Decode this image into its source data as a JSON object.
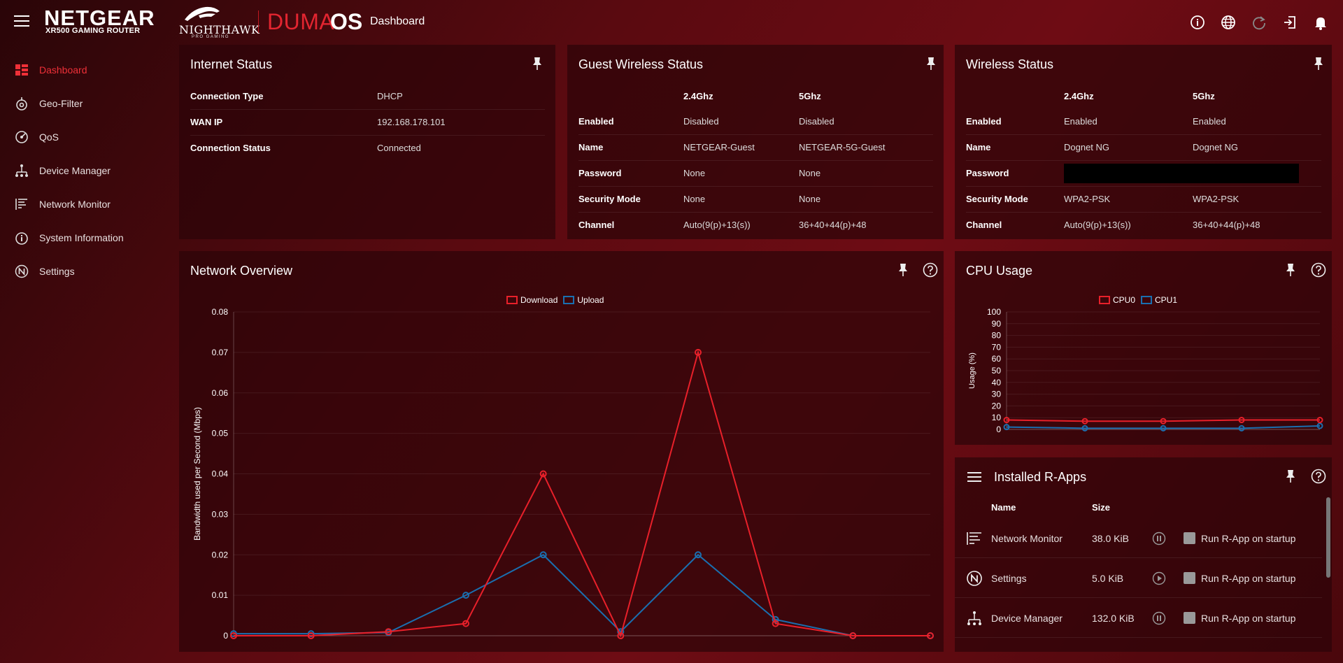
{
  "header": {
    "brand": "NETGEAR",
    "model": "XR500 GAMING ROUTER",
    "nighthawk": "NIGHTHAWK",
    "nighthawk_sub": "PRO GAMING",
    "duma": "DUMA",
    "os": "OS",
    "page_title": "Dashboard",
    "icons": [
      "info-icon",
      "globe-icon",
      "refresh-icon",
      "logout-icon",
      "bell-icon"
    ]
  },
  "sidebar": {
    "items": [
      {
        "label": "Dashboard",
        "icon": "dashboard-icon",
        "active": true
      },
      {
        "label": "Geo-Filter",
        "icon": "geo-filter-icon"
      },
      {
        "label": "QoS",
        "icon": "qos-icon"
      },
      {
        "label": "Device Manager",
        "icon": "device-manager-icon"
      },
      {
        "label": "Network Monitor",
        "icon": "network-monitor-icon"
      },
      {
        "label": "System Information",
        "icon": "system-info-icon"
      },
      {
        "label": "Settings",
        "icon": "settings-icon"
      }
    ]
  },
  "internet_status": {
    "title": "Internet Status",
    "rows": [
      {
        "key": "Connection Type",
        "value": "DHCP"
      },
      {
        "key": "WAN IP",
        "value": "192.168.178.101"
      },
      {
        "key": "Connection Status",
        "value": "Connected"
      }
    ]
  },
  "guest_wireless": {
    "title": "Guest Wireless Status",
    "col1": "2.4Ghz",
    "col2": "5Ghz",
    "rows": [
      {
        "key": "Enabled",
        "v1": "Disabled",
        "v2": "Disabled"
      },
      {
        "key": "Name",
        "v1": "NETGEAR-Guest",
        "v2": "NETGEAR-5G-Guest"
      },
      {
        "key": "Password",
        "v1": "None",
        "v2": "None"
      },
      {
        "key": "Security Mode",
        "v1": "None",
        "v2": "None"
      },
      {
        "key": "Channel",
        "v1": "Auto(9(p)+13(s))",
        "v2": "36+40+44(p)+48"
      }
    ]
  },
  "wireless": {
    "title": "Wireless Status",
    "col1": "2.4Ghz",
    "col2": "5Ghz",
    "rows": [
      {
        "key": "Enabled",
        "v1": "Enabled",
        "v2": "Enabled"
      },
      {
        "key": "Name",
        "v1": "Dognet NG",
        "v2": "Dognet NG"
      },
      {
        "key": "Password",
        "v1": "",
        "v2": "",
        "redacted": true
      },
      {
        "key": "Security Mode",
        "v1": "WPA2-PSK",
        "v2": "WPA2-PSK"
      },
      {
        "key": "Channel",
        "v1": "Auto(9(p)+13(s))",
        "v2": "36+40+44(p)+48"
      }
    ]
  },
  "network_overview": {
    "title": "Network Overview",
    "legend": [
      "Download",
      "Upload"
    ]
  },
  "cpu_usage": {
    "title": "CPU Usage",
    "legend": [
      "CPU0",
      "CPU1"
    ]
  },
  "rapps": {
    "title": "Installed R-Apps",
    "col_name": "Name",
    "col_size": "Size",
    "startup_label": "Run R-App on startup",
    "items": [
      {
        "name": "Network Monitor",
        "size": "38.0 KiB",
        "icon": "network-monitor-icon",
        "state": "pause"
      },
      {
        "name": "Settings",
        "size": "5.0 KiB",
        "icon": "settings-icon",
        "state": "play"
      },
      {
        "name": "Device Manager",
        "size": "132.0 KiB",
        "icon": "device-manager-icon",
        "state": "pause"
      }
    ]
  },
  "colors": {
    "download": "#e8202a",
    "upload": "#1a6fb0",
    "accent": "#ef3038"
  },
  "chart_data": [
    {
      "type": "line",
      "x": [
        0,
        1,
        2,
        3,
        4,
        5,
        6,
        7,
        8,
        9
      ],
      "series": [
        {
          "name": "Download",
          "values": [
            0,
            0,
            0.001,
            0.003,
            0.04,
            0,
            0.07,
            0.003,
            0,
            0
          ]
        },
        {
          "name": "Upload",
          "values": [
            0.0005,
            0.0005,
            0.0008,
            0.01,
            0.02,
            0.001,
            0.02,
            0.004,
            0,
            0
          ]
        }
      ],
      "title": "",
      "xlabel": "",
      "ylabel": "Bandwidth used per Second (Mbps)",
      "ylim": [
        0,
        0.08
      ],
      "yticks": [
        "0",
        "0.01",
        "0.02",
        "0.03",
        "0.04",
        "0.05",
        "0.06",
        "0.07",
        "0.08"
      ],
      "grid": true,
      "legend": "top-center"
    },
    {
      "type": "line",
      "x": [
        0,
        1,
        2,
        3,
        4
      ],
      "series": [
        {
          "name": "CPU0",
          "values": [
            8,
            7,
            7,
            8,
            8
          ]
        },
        {
          "name": "CPU1",
          "values": [
            2,
            1,
            1,
            1,
            3
          ]
        }
      ],
      "title": "",
      "xlabel": "",
      "ylabel": "Usage (%)",
      "ylim": [
        0,
        100
      ],
      "yticks": [
        "0",
        "10",
        "20",
        "30",
        "40",
        "50",
        "60",
        "70",
        "80",
        "90",
        "100"
      ],
      "grid": true,
      "legend": "top-center"
    }
  ]
}
